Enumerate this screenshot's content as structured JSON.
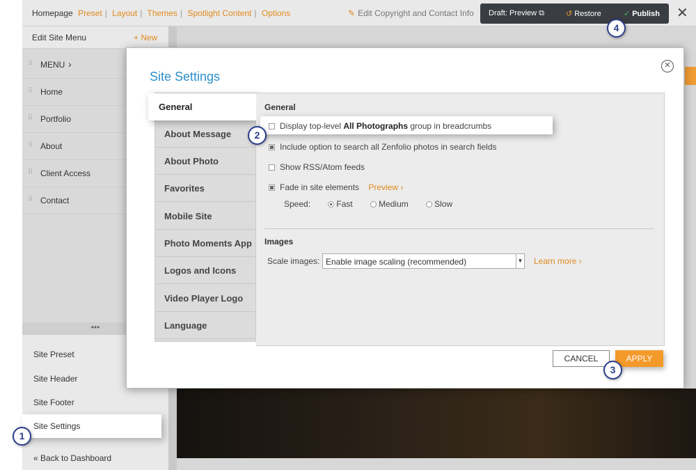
{
  "topbar": {
    "homepage": "Homepage",
    "links": [
      "Preset",
      "Layout",
      "Themes",
      "Spotlight Content",
      "Options"
    ],
    "edit_copyright": "Edit Copyright and Contact Info",
    "draft_preview": "Draft: Preview",
    "restore": "Restore",
    "publish": "Publish"
  },
  "sidebar": {
    "header_title": "Edit Site Menu",
    "new_label": "New",
    "menu_items": [
      "MENU",
      "Home",
      "Portfolio",
      "About",
      "Client Access",
      "Contact"
    ],
    "bottom_items": [
      "Site Preset",
      "Site Header",
      "Site Footer",
      "Site Settings"
    ],
    "selected_item": "Site Settings",
    "back_label": "Back to Dashboard"
  },
  "modal": {
    "title": "Site Settings",
    "tabs": [
      "General",
      "About Message",
      "About Photo",
      "Favorites",
      "Mobile Site",
      "Photo Moments App",
      "Logos and Icons",
      "Video Player Logo",
      "Language"
    ],
    "active_tab": "General",
    "general": {
      "section_title": "General",
      "options": [
        {
          "prefix": "Display top-level ",
          "bold": "All Photographs",
          "suffix": " group in breadcrumbs",
          "checked": false
        },
        {
          "label": "Include option to search all Zenfolio photos in search fields",
          "checked": true
        },
        {
          "label": "Show RSS/Atom feeds",
          "checked": false
        },
        {
          "label": "Fade in site elements",
          "checked": true
        }
      ],
      "preview_link": "Preview",
      "speed_label": "Speed:",
      "speed_options": [
        "Fast",
        "Medium",
        "Slow"
      ],
      "speed_selected": "Fast"
    },
    "images": {
      "section_title": "Images",
      "scale_label": "Scale images:",
      "scale_value": "Enable image scaling (recommended)",
      "learn_more": "Learn more"
    },
    "cancel_label": "CANCEL",
    "apply_label": "APPLY"
  },
  "steps": [
    "1",
    "2",
    "3",
    "4"
  ],
  "colors": {
    "accent_orange": "#f39a2b",
    "link_orange": "#e08a1e",
    "title_blue": "#2b8fc9",
    "step_blue": "#2c3e8c",
    "publish_green": "#44c060"
  },
  "icons": [
    "pencil-icon",
    "external-link-icon",
    "restore-icon",
    "check-circle-icon",
    "close-icon",
    "chevron-right-icon",
    "grip-icon",
    "double-chevron-left-icon",
    "plus-icon"
  ]
}
